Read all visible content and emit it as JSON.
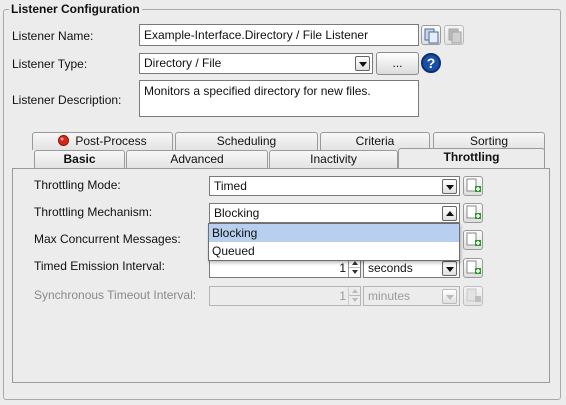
{
  "section": {
    "title": "Listener Configuration"
  },
  "listener": {
    "name_label": "Listener Name:",
    "name_value": "Example-Interface.Directory / File Listener",
    "type_label": "Listener Type:",
    "type_value": "Directory / File",
    "browse_label": "...",
    "help_label": "?",
    "desc_label": "Listener Description:",
    "desc_value": "Monitors a specified directory for new files."
  },
  "tabs": {
    "back_row": [
      "Post-Process",
      "Scheduling",
      "Criteria",
      "Sorting"
    ],
    "front_row": [
      "Basic",
      "Advanced",
      "Inactivity",
      "Throttling"
    ],
    "active": "Throttling"
  },
  "throttling": {
    "mode_label": "Throttling Mode:",
    "mode_value": "Timed",
    "mechanism_label": "Throttling Mechanism:",
    "mechanism_value": "Blocking",
    "mechanism_options": [
      "Blocking",
      "Queued"
    ],
    "max_concurrent_label": "Max Concurrent Messages:",
    "emission_label": "Timed Emission Interval:",
    "emission_value": "1",
    "emission_unit": "seconds",
    "sync_timeout_label": "Synchronous Timeout Interval:",
    "sync_timeout_value": "1",
    "sync_timeout_unit": "minutes"
  },
  "icons": {
    "copy": "copy-icon",
    "paste": "paste-icon",
    "help": "help-icon",
    "add": "add-variable-icon",
    "warning": "error-indicator-icon"
  },
  "colors": {
    "help_blue": "#1a4fa8",
    "selection": "#b8cff0",
    "add_green": "#2e9a2e",
    "error_red": "#d42a1a"
  }
}
